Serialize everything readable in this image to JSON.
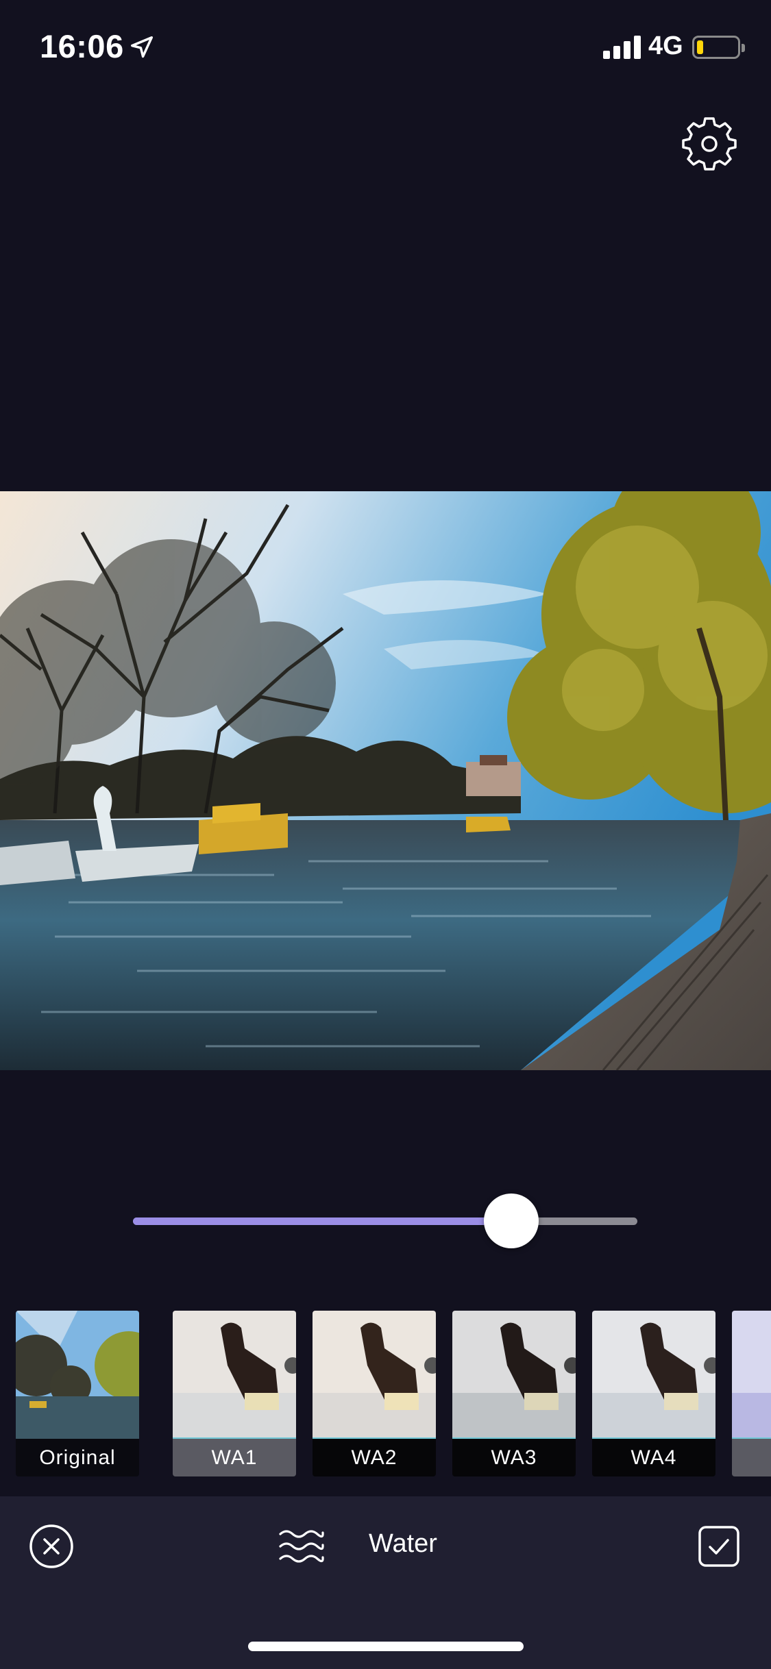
{
  "status": {
    "time": "16:06",
    "network": "4G",
    "location_icon": "location-arrow-icon",
    "signal_bars": 4,
    "battery_level": 0.1,
    "battery_color": "#ffd60a"
  },
  "toolbar": {
    "settings_icon": "gear-icon"
  },
  "photo": {
    "description_icon": "photo-preview"
  },
  "slider": {
    "value": 0.75,
    "accent": "#9b8ee6"
  },
  "filters": {
    "items": [
      {
        "label": "Original",
        "selected": false
      },
      {
        "label": "WA1",
        "selected": true
      },
      {
        "label": "WA2",
        "selected": false
      },
      {
        "label": "WA3",
        "selected": false
      },
      {
        "label": "WA4",
        "selected": false
      },
      {
        "label": "",
        "selected": false
      }
    ],
    "accent": "#6fc7d6"
  },
  "bottom": {
    "title": "Water",
    "close_icon": "close-circle-icon",
    "category_icon": "water-waves-icon",
    "confirm_icon": "checkmark-square-icon"
  }
}
